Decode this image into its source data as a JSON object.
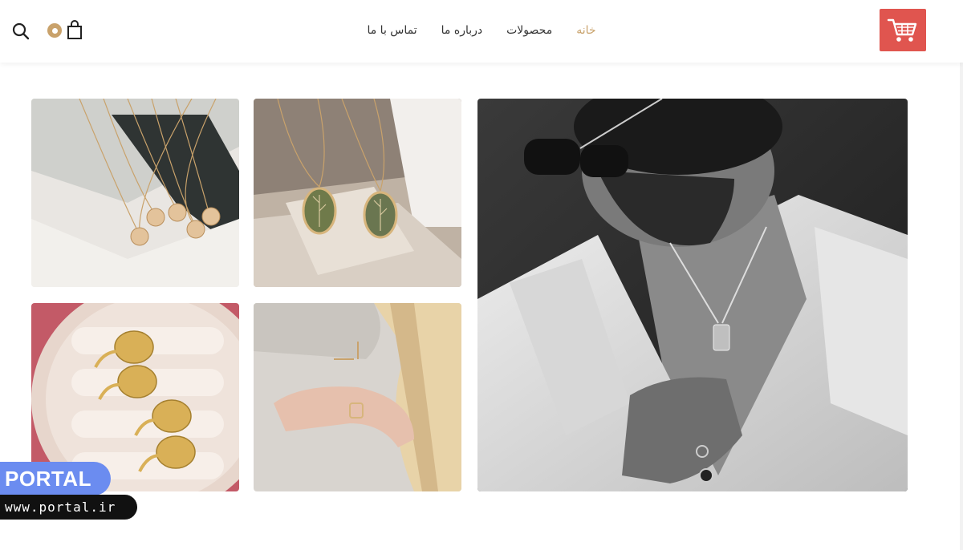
{
  "header": {
    "nav": [
      {
        "label": "خانه",
        "active": true
      },
      {
        "label": "محصولات",
        "active": false
      },
      {
        "label": "درباره ما",
        "active": false
      },
      {
        "label": "تماس با ما",
        "active": false
      }
    ],
    "logo_icon": "shopping-cart-icon",
    "search_icon": "search-icon",
    "cart_icon": "shopping-bag-icon"
  },
  "gallery": {
    "images": [
      {
        "name": "man-with-pendant-photo"
      },
      {
        "name": "coin-necklaces-photo"
      },
      {
        "name": "oval-pendants-photo"
      },
      {
        "name": "signet-rings-photo"
      },
      {
        "name": "sweater-ring-photo"
      }
    ]
  },
  "watermark": {
    "title": "PORTAL",
    "url": "www.portal.ir"
  },
  "colors": {
    "accent": "#c9a26b",
    "logo_bg": "#e0554f",
    "watermark_blue": "#6b8cf0"
  }
}
